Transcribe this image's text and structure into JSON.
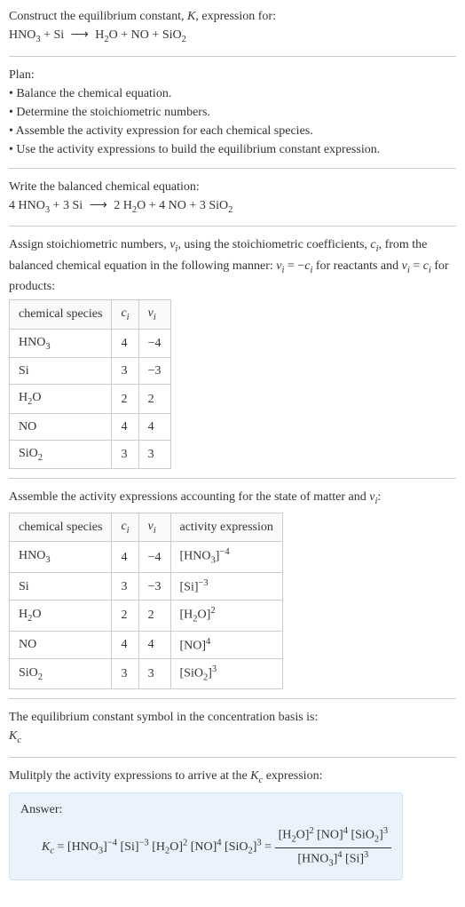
{
  "header": {
    "prompt": "Construct the equilibrium constant, ",
    "Ksym": "K",
    "prompt2": ", expression for:",
    "equation_lhs": "HNO",
    "equation": {
      "r1": "HNO",
      "r1sub": "3",
      "plus1": " + ",
      "r2": "Si",
      "arrow": "⟶",
      "p1": "H",
      "p1sub": "2",
      "p1b": "O",
      "plus2": " + ",
      "p2": "NO",
      "plus3": " + ",
      "p3": "SiO",
      "p3sub": "2"
    }
  },
  "plan": {
    "title": "Plan:",
    "b1": "• Balance the chemical equation.",
    "b2": "• Determine the stoichiometric numbers.",
    "b3": "• Assemble the activity expression for each chemical species.",
    "b4": "• Use the activity expressions to build the equilibrium constant expression."
  },
  "balanced": {
    "title": "Write the balanced chemical equation:",
    "c1": "4 ",
    "s1": "HNO",
    "s1sub": "3",
    "plus1": " + ",
    "c2": "3 ",
    "s2": "Si",
    "arrow": "⟶",
    "c3": "2 ",
    "s3": "H",
    "s3sub": "2",
    "s3b": "O",
    "plus2": " + ",
    "c4": "4 ",
    "s4": "NO",
    "plus3": " + ",
    "c5": "3 ",
    "s5": "SiO",
    "s5sub": "2"
  },
  "stoich": {
    "intro1": "Assign stoichiometric numbers, ",
    "nu": "ν",
    "nuisub": "i",
    "intro2": ", using the stoichiometric coefficients, ",
    "c": "c",
    "cisub": "i",
    "intro3": ", from the balanced chemical equation in the following manner: ",
    "rel1a": "ν",
    "rel1b": " = −",
    "rel1c": "c",
    "intro4": " for reactants and ",
    "rel2a": "ν",
    "rel2b": " = ",
    "rel2c": "c",
    "intro5": " for products:",
    "headers": {
      "h1": "chemical species",
      "h2": "c",
      "h2sub": "i",
      "h3": "ν",
      "h3sub": "i"
    },
    "rows": [
      {
        "sp": "HNO",
        "spsub": "3",
        "c": "4",
        "nu": "−4"
      },
      {
        "sp": "Si",
        "spsub": "",
        "c": "3",
        "nu": "−3"
      },
      {
        "sp": "H",
        "spsub": "2",
        "spb": "O",
        "c": "2",
        "nu": "2"
      },
      {
        "sp": "NO",
        "spsub": "",
        "c": "4",
        "nu": "4"
      },
      {
        "sp": "SiO",
        "spsub": "2",
        "c": "3",
        "nu": "3"
      }
    ]
  },
  "activity": {
    "title1": "Assemble the activity expressions accounting for the state of matter and ",
    "nu": "ν",
    "nuisub": "i",
    "title2": ":",
    "headers": {
      "h1": "chemical species",
      "h2": "c",
      "h2sub": "i",
      "h3": "ν",
      "h3sub": "i",
      "h4": "activity expression"
    },
    "rows": [
      {
        "sp": "HNO",
        "spsub": "3",
        "c": "4",
        "nu": "−4",
        "act": "[HNO",
        "actsub": "3",
        "act2": "]",
        "exp": "−4"
      },
      {
        "sp": "Si",
        "spsub": "",
        "c": "3",
        "nu": "−3",
        "act": "[Si]",
        "actsub": "",
        "act2": "",
        "exp": "−3"
      },
      {
        "sp": "H",
        "spsub": "2",
        "spb": "O",
        "c": "2",
        "nu": "2",
        "act": "[H",
        "actsub": "2",
        "act2": "O]",
        "exp": "2"
      },
      {
        "sp": "NO",
        "spsub": "",
        "c": "4",
        "nu": "4",
        "act": "[NO]",
        "actsub": "",
        "act2": "",
        "exp": "4"
      },
      {
        "sp": "SiO",
        "spsub": "2",
        "c": "3",
        "nu": "3",
        "act": "[SiO",
        "actsub": "2",
        "act2": "]",
        "exp": "3"
      }
    ]
  },
  "kc_symbol": {
    "line1": "The equilibrium constant symbol in the concentration basis is:",
    "K": "K",
    "sub": "c"
  },
  "multiply": {
    "line": "Mulitply the activity expressions to arrive at the ",
    "K": "K",
    "sub": "c",
    "line2": " expression:"
  },
  "answer": {
    "label": "Answer:",
    "Kc": "K",
    "Kcsub": "c",
    "eq": " = ",
    "t1": "[HNO",
    "t1sub": "3",
    "t1b": "]",
    "e1": "−4",
    "sp1": " ",
    "t2": "[Si]",
    "e2": "−3",
    "sp2": " ",
    "t3": "[H",
    "t3sub": "2",
    "t3b": "O]",
    "e3": "2",
    "sp3": " ",
    "t4": "[NO]",
    "e4": "4",
    "sp4": " ",
    "t5": "[SiO",
    "t5sub": "2",
    "t5b": "]",
    "e5": "3",
    "eq2": " = ",
    "num1": "[H",
    "num1sub": "2",
    "num1b": "O]",
    "ne1": "2",
    "nsp1": " ",
    "num2": "[NO]",
    "ne2": "4",
    "nsp2": " ",
    "num3": "[SiO",
    "num3sub": "2",
    "num3b": "]",
    "ne3": "3",
    "den1": "[HNO",
    "den1sub": "3",
    "den1b": "]",
    "de1": "4",
    "dsp1": " ",
    "den2": "[Si]",
    "de2": "3"
  }
}
